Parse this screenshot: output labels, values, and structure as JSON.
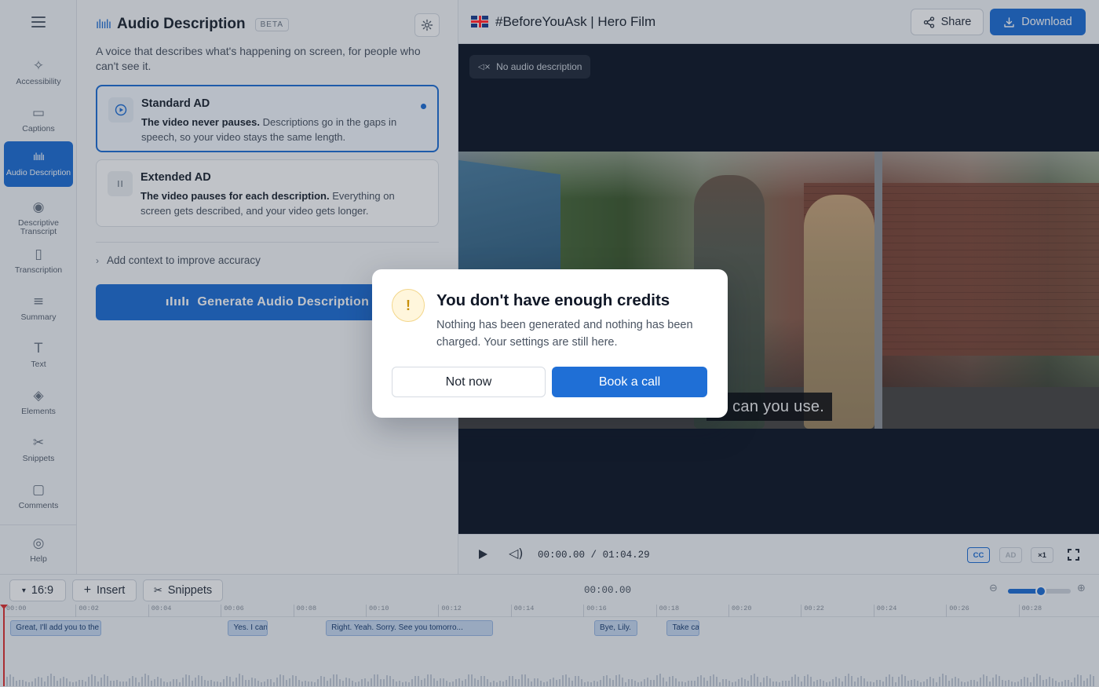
{
  "sidebar": {
    "items": [
      {
        "label": "Accessibility",
        "icon": "accessibility-icon",
        "glyph": "✧"
      },
      {
        "label": "Captions",
        "icon": "captions-icon",
        "glyph": "▭"
      },
      {
        "label": "Audio Description",
        "icon": "audio-wave-icon",
        "glyph": "ılıılı",
        "active": true
      },
      {
        "label": "Descriptive Transcript",
        "icon": "eye-icon",
        "glyph": "◉"
      },
      {
        "label": "Transcription",
        "icon": "document-icon",
        "glyph": "▯"
      },
      {
        "label": "Summary",
        "icon": "summary-lines-icon",
        "glyph": "≡"
      },
      {
        "label": "Text",
        "icon": "text-icon",
        "glyph": "T"
      },
      {
        "label": "Elements",
        "icon": "layers-icon",
        "glyph": "◈"
      },
      {
        "label": "Snippets",
        "icon": "scissors-icon",
        "glyph": "✂"
      },
      {
        "label": "Comments",
        "icon": "comment-icon",
        "glyph": "▢"
      },
      {
        "label": "Help",
        "icon": "lifebuoy-icon",
        "glyph": "◎"
      }
    ]
  },
  "panel": {
    "title": "Audio Description",
    "badge": "BETA",
    "description": "A voice that describes what's happening on screen, for people who can't see it.",
    "options": [
      {
        "title": "Standard AD",
        "bold": "The video never pauses.",
        "text": " Descriptions go in the gaps in speech, so your video stays the same length.",
        "selected": true
      },
      {
        "title": "Extended AD",
        "bold": "The video pauses for each description.",
        "text": " Everything on screen gets described, and your video gets longer.",
        "selected": false
      }
    ],
    "context_link": "Add context to improve accuracy",
    "generate_button": "Generate Audio Description"
  },
  "topbar": {
    "title": "#BeforeYouAsk | Hero Film",
    "share": "Share",
    "download": "Download"
  },
  "video": {
    "ad_status": "No audio description",
    "subtitle": "h, can you use."
  },
  "player": {
    "current": "00:00.00",
    "separator": "/",
    "duration": "01:04.29",
    "cc": "CC",
    "ad": "AD",
    "speed": "×1"
  },
  "timeline": {
    "aspect": "16:9",
    "insert": "Insert",
    "snippets": "Snippets",
    "time": "00:00.00",
    "zoom_level": 0.52,
    "ticks": [
      "00:00",
      "00:02",
      "00:04",
      "00:06",
      "00:08",
      "00:10",
      "00:12",
      "00:14",
      "00:16",
      "00:18",
      "00:20",
      "00:22",
      "00:24",
      "00:26",
      "00:28"
    ],
    "clips": [
      {
        "text": "Great, I'll add you to the group. Oh...",
        "start": 0.2,
        "end": 2.7
      },
      {
        "text": "Yes. I can use a pho",
        "start": 6.2,
        "end": 7.3
      },
      {
        "text": "Right. Yeah. Sorry. See you tomorro...",
        "start": 8.9,
        "end": 13.5
      },
      {
        "text": "Bye, Lily.",
        "start": 16.3,
        "end": 17.5
      },
      {
        "text": "Take care.",
        "start": 18.3,
        "end": 19.2
      }
    ]
  },
  "modal": {
    "icon": "!",
    "title": "You don't have enough credits",
    "body": "Nothing has been generated and nothing has been charged. Your settings are still here.",
    "secondary": "Not now",
    "primary": "Book a call"
  },
  "colors": {
    "accent": "#1f6fd6",
    "video_bg": "#0f1726",
    "warning": "#c8900a"
  }
}
